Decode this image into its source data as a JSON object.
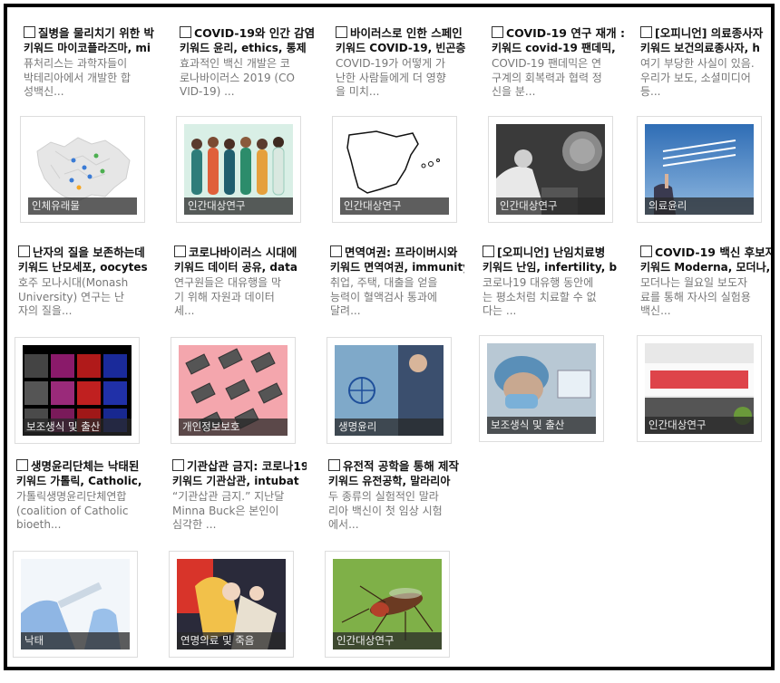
{
  "articles": [
    {
      "title": "질병을 물리치기 위한 박",
      "keywords": "키워드 마이코플라즈마, mi",
      "desc": "퓨처리스는 과학자들이 박테리아에서 개발한 합성백신...",
      "tag": "인체유래물",
      "image": "map-europe"
    },
    {
      "title": "COVID-19와 인간 감염",
      "keywords": "키워드 윤리, ethics, 통제",
      "desc": "효과적인 백신 개발은 코로나바이러스 2019 (COVID-19) ...",
      "tag": "인간대상연구",
      "image": "people-illustration"
    },
    {
      "title": "바이러스로 인한 스페인",
      "keywords": "키워드 COVID-19, 빈곤층",
      "desc": "COVID-19가 어떻게 가난한 사람들에게 더 영향을 미치...",
      "tag": "인간대상연구",
      "image": "spain-outline"
    },
    {
      "title": "COVID-19 연구 재개 :",
      "keywords": "키워드 covid-19 팬데믹,",
      "desc": "COVID-19 팬데믹은 연구계의 회복력과 협력 정신을 분...",
      "tag": "인간대상연구",
      "image": "lab-researcher"
    },
    {
      "title": "[오피니언] 의료종사자",
      "keywords": "키워드 보건의료종사자, h",
      "desc": "여기 부당한 사실이 있음. 우리가 보도, 소셜미디어 등...",
      "tag": "의료윤리",
      "image": "airshow"
    },
    {
      "title": "난자의 질을 보존하는데",
      "keywords": "키워드 난모세포, oocytes",
      "desc": "호주 모나시대(Monash University) 연구는 난자의 질을...",
      "tag": "보조생식 및 출산",
      "image": "microscopy-grid"
    },
    {
      "title": "코로나바이러스 시대에",
      "keywords": "키워드 데이터 공유, data",
      "desc": "연구원들은 대유행을 막기 위해 자원과 데이터 세...",
      "tag": "개인정보보호",
      "image": "laptops-pink"
    },
    {
      "title": "면역여권: 프라이버시와",
      "keywords": "키워드 면역여권, immunity",
      "desc": "취업, 주택, 대출을 얻을 능력이 혈액검사 통과에 달려...",
      "tag": "생명윤리",
      "image": "immunity-passport"
    },
    {
      "title": "[오피니언] 난임치료병",
      "keywords": "키워드 난임, infertility, b",
      "desc": "코로나19 대유행 동안에는 평소처럼 치료할 수 없다는 ...",
      "tag": "보조생식 및 출산",
      "image": "lab-mask"
    },
    {
      "title": "COVID-19 백신 후보자",
      "keywords": "키워드 Moderna, 모더나,",
      "desc": "모더나는 월요일 보도자료를 통해 자사의 실험용 백신...",
      "tag": "인간대상연구",
      "image": "moderna-sign"
    },
    {
      "title": "생명윤리단체는 낙태된",
      "keywords": "키워드 가톨릭, Catholic,",
      "desc": "가톨릭생명윤리단체연합(coalition of Catholic bioeth...",
      "tag": "낙태",
      "image": "vaccine-syringe"
    },
    {
      "title": "기관삽관 금지: 코로나19",
      "keywords": "키워드 기관삽관, intubat",
      "desc": "“기관삽관 금지.” 지난달 Minna Buck은 본인이 심각한 ...",
      "tag": "연명의료 및 죽음",
      "image": "women-illustration"
    },
    {
      "title": "유전적 공학을 통해 제작",
      "keywords": "키워드 유전공학, 말라리아",
      "desc": "두 종류의 실험적인 말라리아 백신이 첫 임상 시험에서...",
      "tag": "인간대상연구",
      "image": "mosquito"
    }
  ]
}
